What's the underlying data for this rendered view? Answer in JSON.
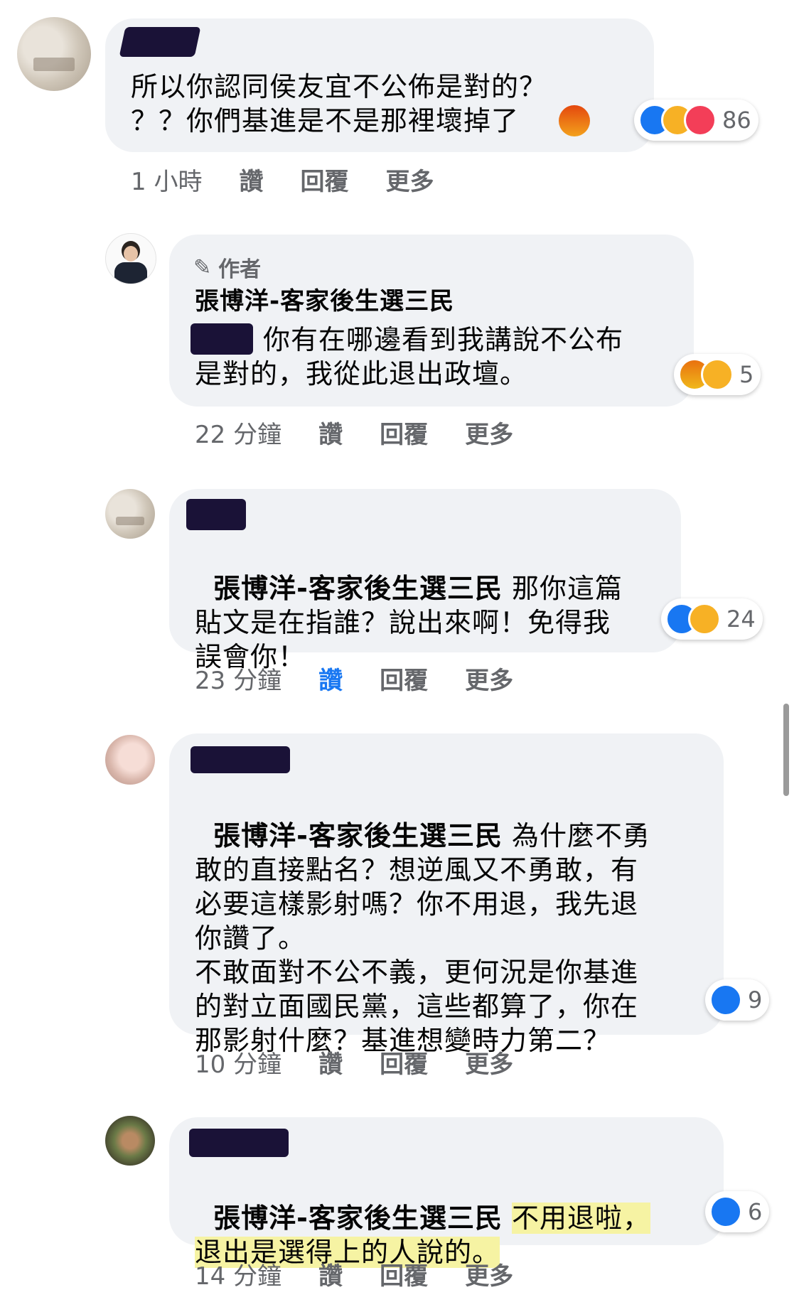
{
  "comments": [
    {
      "text": "所以你認同侯友宜不公佈是對的？\n？？你們基進是不是那裡壞掉了",
      "reactions": {
        "count": "86",
        "icons": [
          "like-icon",
          "haha-icon",
          "love-icon"
        ]
      },
      "meta": {
        "time": "1 小時",
        "like": "讚",
        "reply": "回覆",
        "more": "更多"
      }
    },
    {
      "author_tag": "作者",
      "author": "張博洋-客家後生選三民",
      "text": "你有在哪邊看到我講說不公布\n是對的，我從此退出政壇。",
      "reactions": {
        "count": "5",
        "icons": [
          "angry-icon",
          "haha-icon"
        ]
      },
      "meta": {
        "time": "22 分鐘",
        "like": "讚",
        "reply": "回覆",
        "more": "更多"
      }
    },
    {
      "mention": "張博洋-客家後生選三民",
      "text": " 那你這篇\n貼文是在指誰？說出來啊！免得我\n誤會你！",
      "reactions": {
        "count": "24",
        "icons": [
          "like-icon",
          "haha-icon"
        ]
      },
      "meta": {
        "time": "23 分鐘",
        "like": "讚",
        "reply": "回覆",
        "more": "更多"
      }
    },
    {
      "mention": "張博洋-客家後生選三民",
      "text": " 為什麼不勇\n敢的直接點名？想逆風又不勇敢，有\n必要這樣影射嗎？你不用退，我先退\n你讚了。\n不敢面對不公不義，更何況是你基進\n的對立面國民黨，這些都算了，你在\n那影射什麼？基進想變時力第二？",
      "reactions": {
        "count": "9",
        "icons": [
          "like-icon"
        ]
      },
      "meta": {
        "time": "10 分鐘",
        "like": "讚",
        "reply": "回覆",
        "more": "更多"
      }
    },
    {
      "mention": "張博洋-客家後生選三民",
      "text_highlight_1": "不用退啦，",
      "text_highlight_2": "退出是選得上的人說的。",
      "reactions": {
        "count": "6",
        "icons": [
          "like-icon"
        ]
      },
      "meta": {
        "time": "14 分鐘",
        "like": "讚",
        "reply": "回覆",
        "more": "更多"
      }
    }
  ],
  "colors": {
    "bubble": "#f0f2f5",
    "meta": "#65676b",
    "liked": "#1877f2",
    "highlight": "#f6f3a3"
  }
}
